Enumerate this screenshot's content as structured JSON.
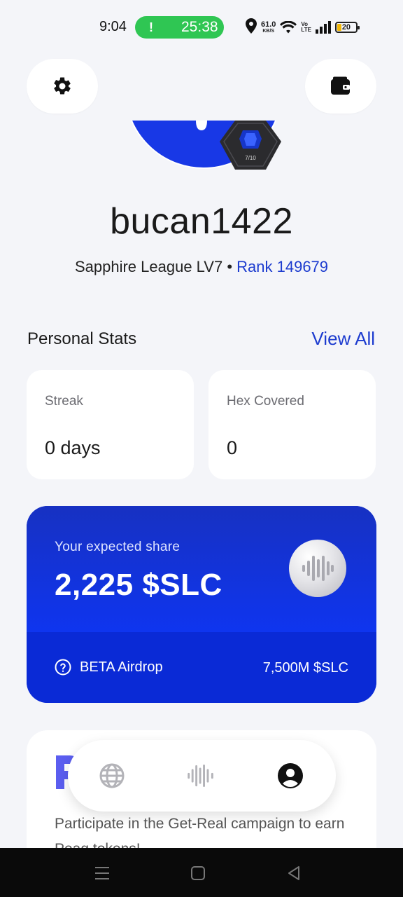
{
  "status_bar": {
    "time": "9:04",
    "call_timer": "25:38",
    "call_indicator": "!",
    "net_speed_value": "61.0",
    "net_speed_unit": "KB/S",
    "volte_top": "Vo",
    "volte_bottom": "LTE",
    "battery_level": "20",
    "call_color": "#2fc653"
  },
  "header": {
    "settings_icon": "gear-icon",
    "wallet_icon": "wallet-icon"
  },
  "profile": {
    "badge_text": "7/10",
    "username": "bucan1422",
    "league": "Sapphire League LV7",
    "separator": "•",
    "rank": "Rank 149679"
  },
  "stats": {
    "title": "Personal Stats",
    "view_all": "View All",
    "cards": [
      {
        "label": "Streak",
        "value": "0 days"
      },
      {
        "label": "Hex Covered",
        "value": "0"
      }
    ]
  },
  "share": {
    "caption": "Your expected share",
    "amount": "2,225 $SLC",
    "beta_label": "BETA Airdrop",
    "total": "7,500M $SLC",
    "accent": "#0f35ef"
  },
  "campaign": {
    "text": "Participate in the Get-Real campaign to earn Peaq tokens!"
  },
  "bottom_nav": {
    "items": [
      "globe-icon",
      "waves-icon",
      "profile-icon"
    ],
    "active": "profile-icon"
  },
  "colors": {
    "brand_blue": "#1d3ccf",
    "background": "#f4f5f9"
  }
}
